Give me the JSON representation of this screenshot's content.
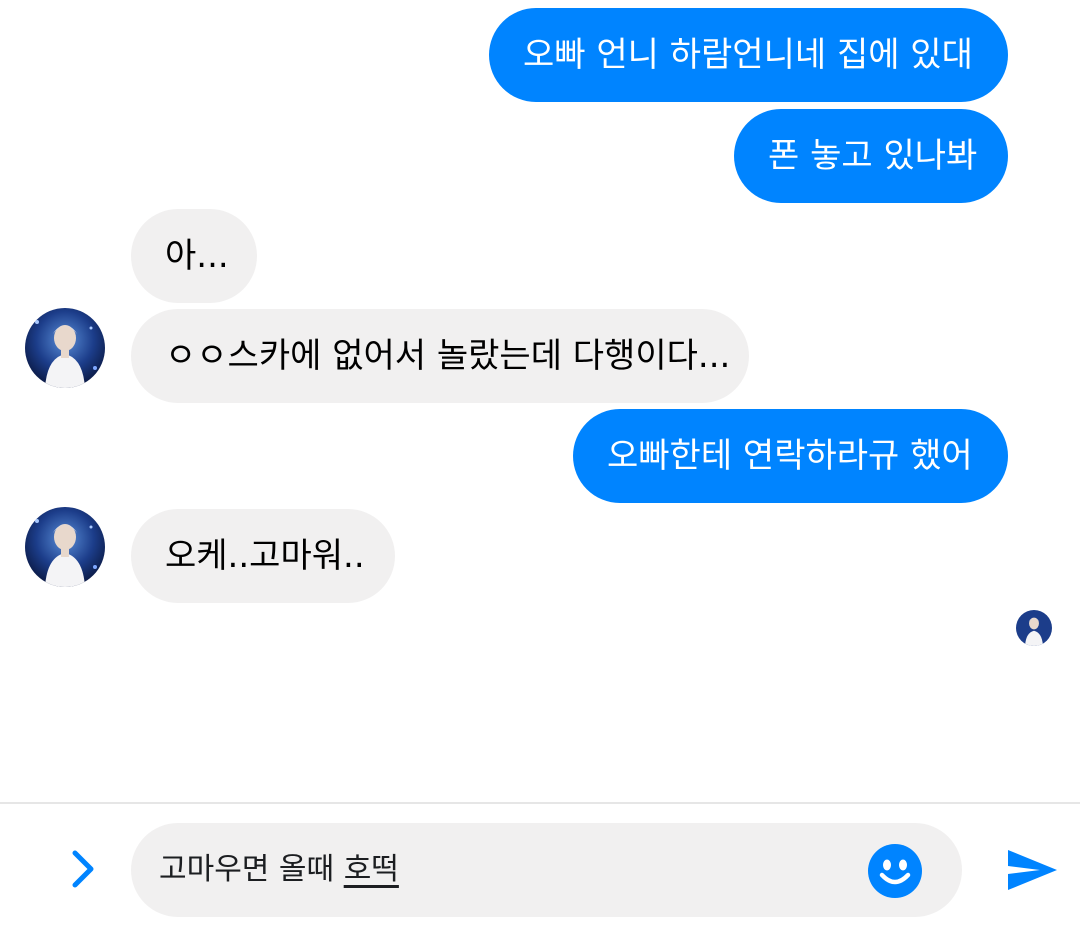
{
  "colors": {
    "sent_bubble": "#0084ff",
    "received_bubble": "#f1f0f0",
    "accent": "#0084ff"
  },
  "messages": [
    {
      "direction": "sent",
      "text": "오빠 언니 하람언니네 집에 있대"
    },
    {
      "direction": "sent",
      "text": "폰 놓고 있나봐"
    },
    {
      "direction": "received",
      "text": "아..."
    },
    {
      "direction": "received",
      "text": "ㅇㅇ스카에 없어서 놀랐는데 다행이다..."
    },
    {
      "direction": "sent",
      "text": "오빠한테 연락하라규 했어"
    },
    {
      "direction": "received",
      "text": "오케..고마워.."
    }
  ],
  "composer": {
    "text_prefix": "고마우면 올때 ",
    "text_underlined": "호떡",
    "expand_icon": "chevron-right-icon",
    "emoji_icon": "smiley-icon",
    "send_icon": "send-icon"
  }
}
